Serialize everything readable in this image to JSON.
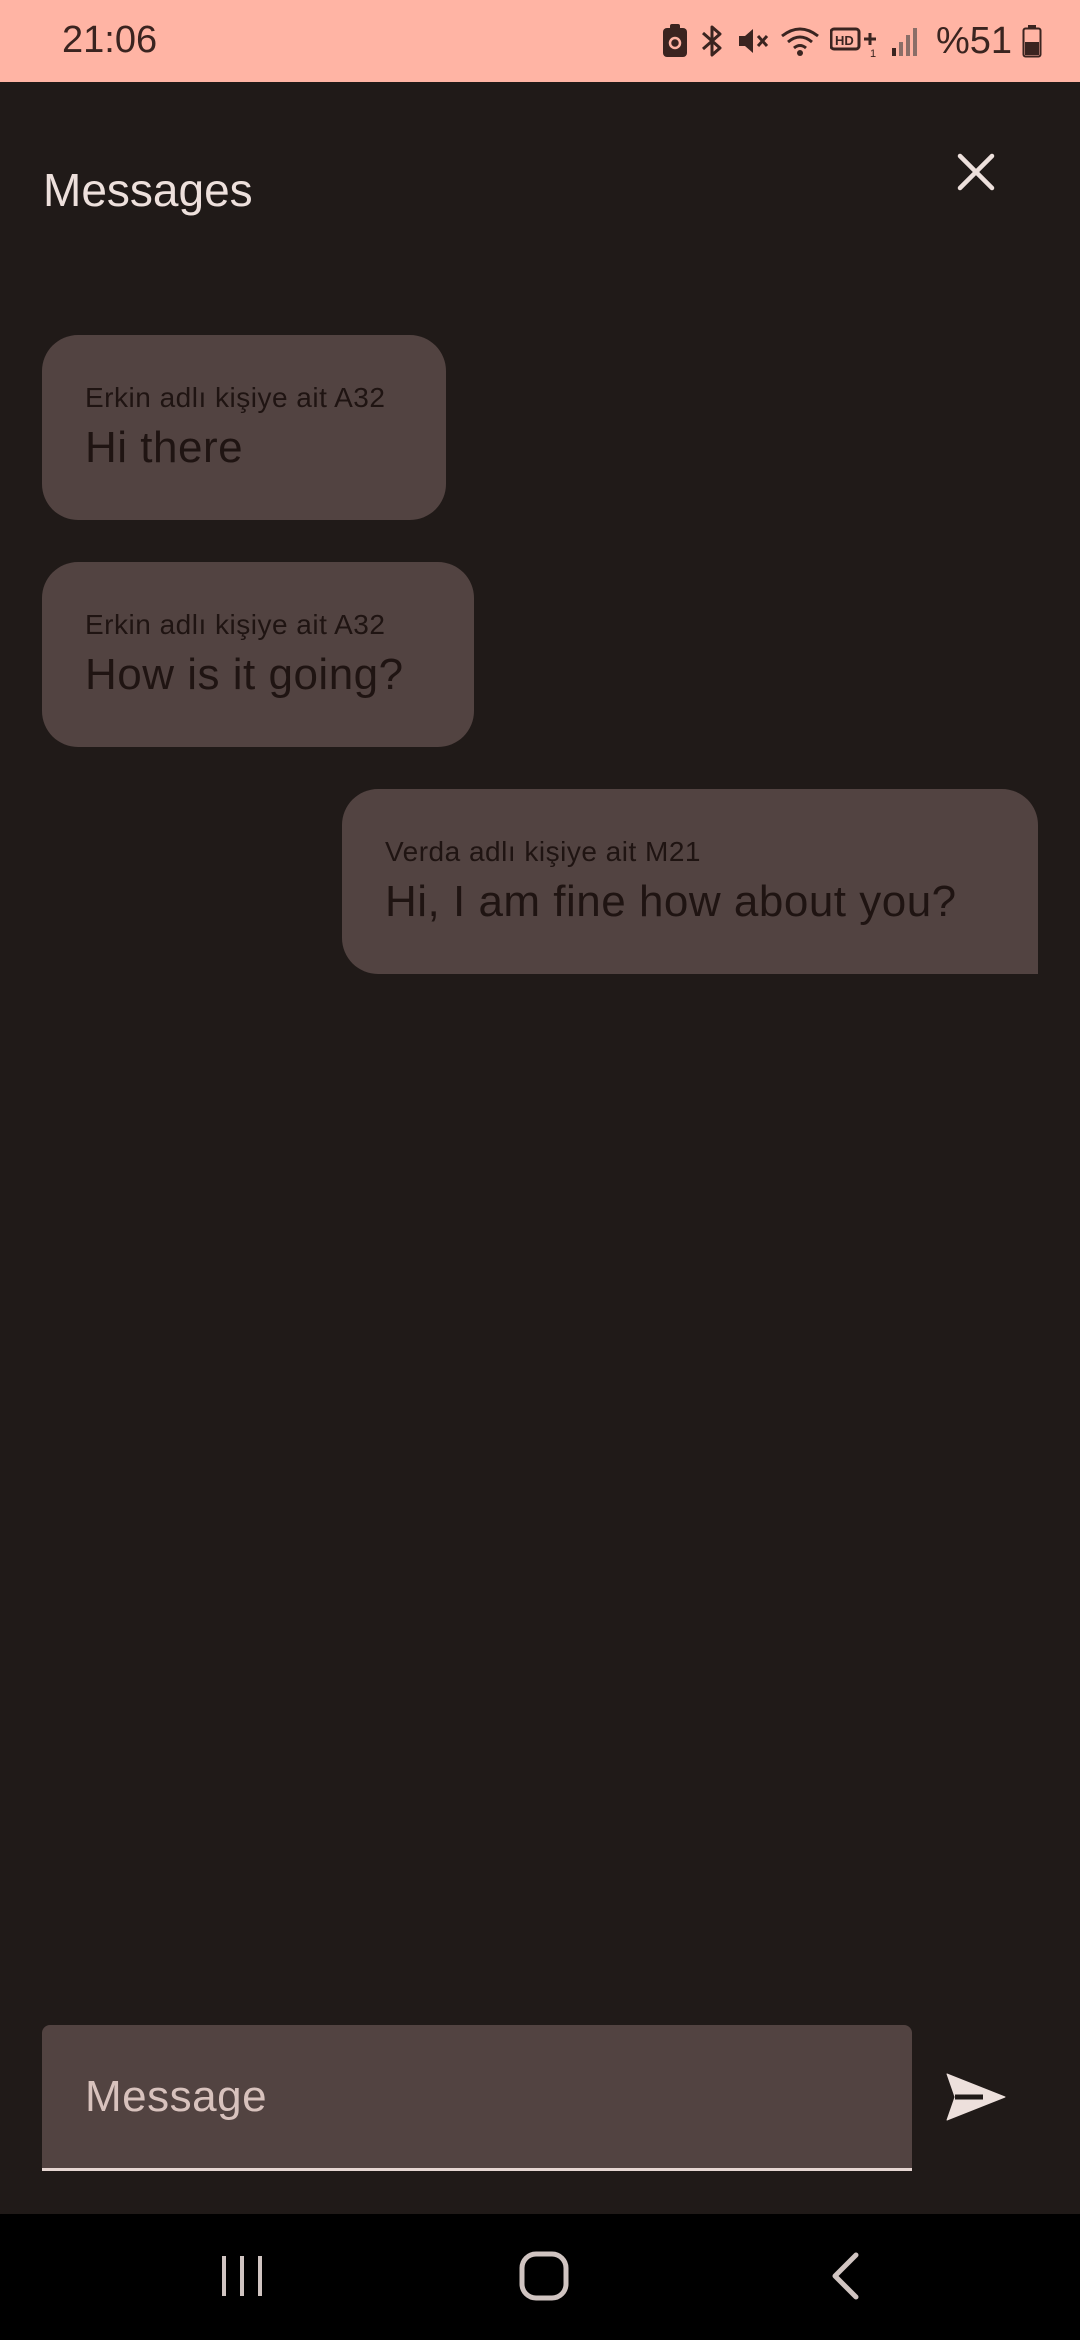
{
  "status_bar": {
    "time": "21:06",
    "battery_percent": "%51",
    "icons": [
      "sim-lock-icon",
      "bluetooth-icon",
      "mute-icon",
      "wifi-icon",
      "hd-voice-icon",
      "signal-icon",
      "battery-icon"
    ],
    "background_color": "#ffb4a4"
  },
  "app_bar": {
    "title": "Messages",
    "close_icon": "close-icon"
  },
  "messages": [
    {
      "sender": "Erkin adlı kişiye ait A32",
      "text": "Hi there",
      "side": "left"
    },
    {
      "sender": "Erkin adlı kişiye ait A32",
      "text": "How is it going?",
      "side": "left"
    },
    {
      "sender": "Verda adlı kişiye ait M21",
      "text": "Hi, I am fine how about you?",
      "side": "right"
    }
  ],
  "composer": {
    "placeholder": "Message",
    "value": "",
    "send_icon": "send-icon"
  },
  "nav_bar": {
    "buttons": [
      "recents-icon",
      "home-icon",
      "back-icon"
    ]
  },
  "colors": {
    "background": "#201a18",
    "bubble": "#524341",
    "text_on_bubble": "#1f1412",
    "title": "#ede0dc"
  }
}
